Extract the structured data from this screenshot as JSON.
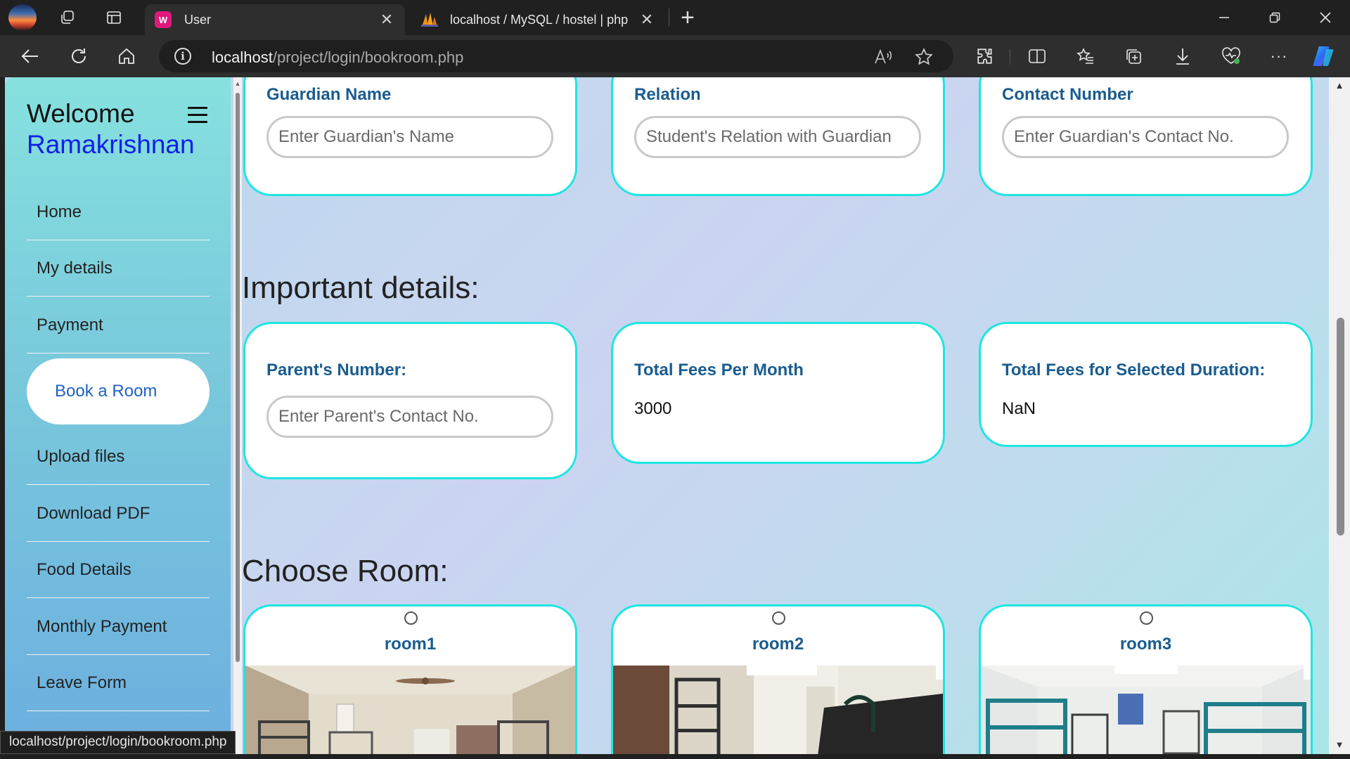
{
  "browser": {
    "tabs": [
      {
        "title": "User",
        "active": true
      },
      {
        "title": "localhost / MySQL / hostel | php",
        "active": false
      }
    ],
    "url_host": "localhost",
    "url_path": "/project/login/bookroom.php",
    "status_url": "localhost/project/login/bookroom.php",
    "icons": [
      "profile-icon",
      "workspaces-icon",
      "tab-actions-icon",
      "back-icon",
      "refresh-icon",
      "home-icon",
      "site-info-icon",
      "read-aloud-icon",
      "favorite-star-icon",
      "extensions-icon",
      "split-screen-icon",
      "favorites-icon",
      "collections-icon",
      "downloads-icon",
      "browser-essentials-icon",
      "more-icon",
      "copilot-icon"
    ]
  },
  "sidebar": {
    "welcome": "Welcome",
    "username": "Ramakrishnan",
    "items": [
      {
        "label": "Home"
      },
      {
        "label": "My details"
      },
      {
        "label": "Payment"
      },
      {
        "label": "Book a Room",
        "active": true
      },
      {
        "label": "Upload files"
      },
      {
        "label": "Download PDF"
      },
      {
        "label": "Food Details"
      },
      {
        "label": "Monthly Payment"
      },
      {
        "label": "Leave Form"
      }
    ]
  },
  "guardian": {
    "name_label": "Guardian Name",
    "name_placeholder": "Enter Guardian's Name",
    "relation_label": "Relation",
    "relation_placeholder": "Student's Relation with Guardian",
    "contact_label": "Contact Number",
    "contact_placeholder": "Enter Guardian's Contact No."
  },
  "important": {
    "title": "Important details:",
    "parent_label": "Parent's Number:",
    "parent_placeholder": "Enter Parent's Contact No.",
    "fees_month_label": "Total Fees Per Month",
    "fees_month_value": "3000",
    "fees_total_label": "Total Fees for Selected Duration:",
    "fees_total_value": "NaN"
  },
  "rooms": {
    "title": "Choose Room:",
    "items": [
      {
        "name": "room1"
      },
      {
        "name": "room2"
      },
      {
        "name": "room3"
      }
    ]
  },
  "colors": {
    "card_border": "#1de6e0",
    "label_blue": "#1a5c8f",
    "username_blue": "#1020e8",
    "active_menu_text": "#1f62c4"
  }
}
